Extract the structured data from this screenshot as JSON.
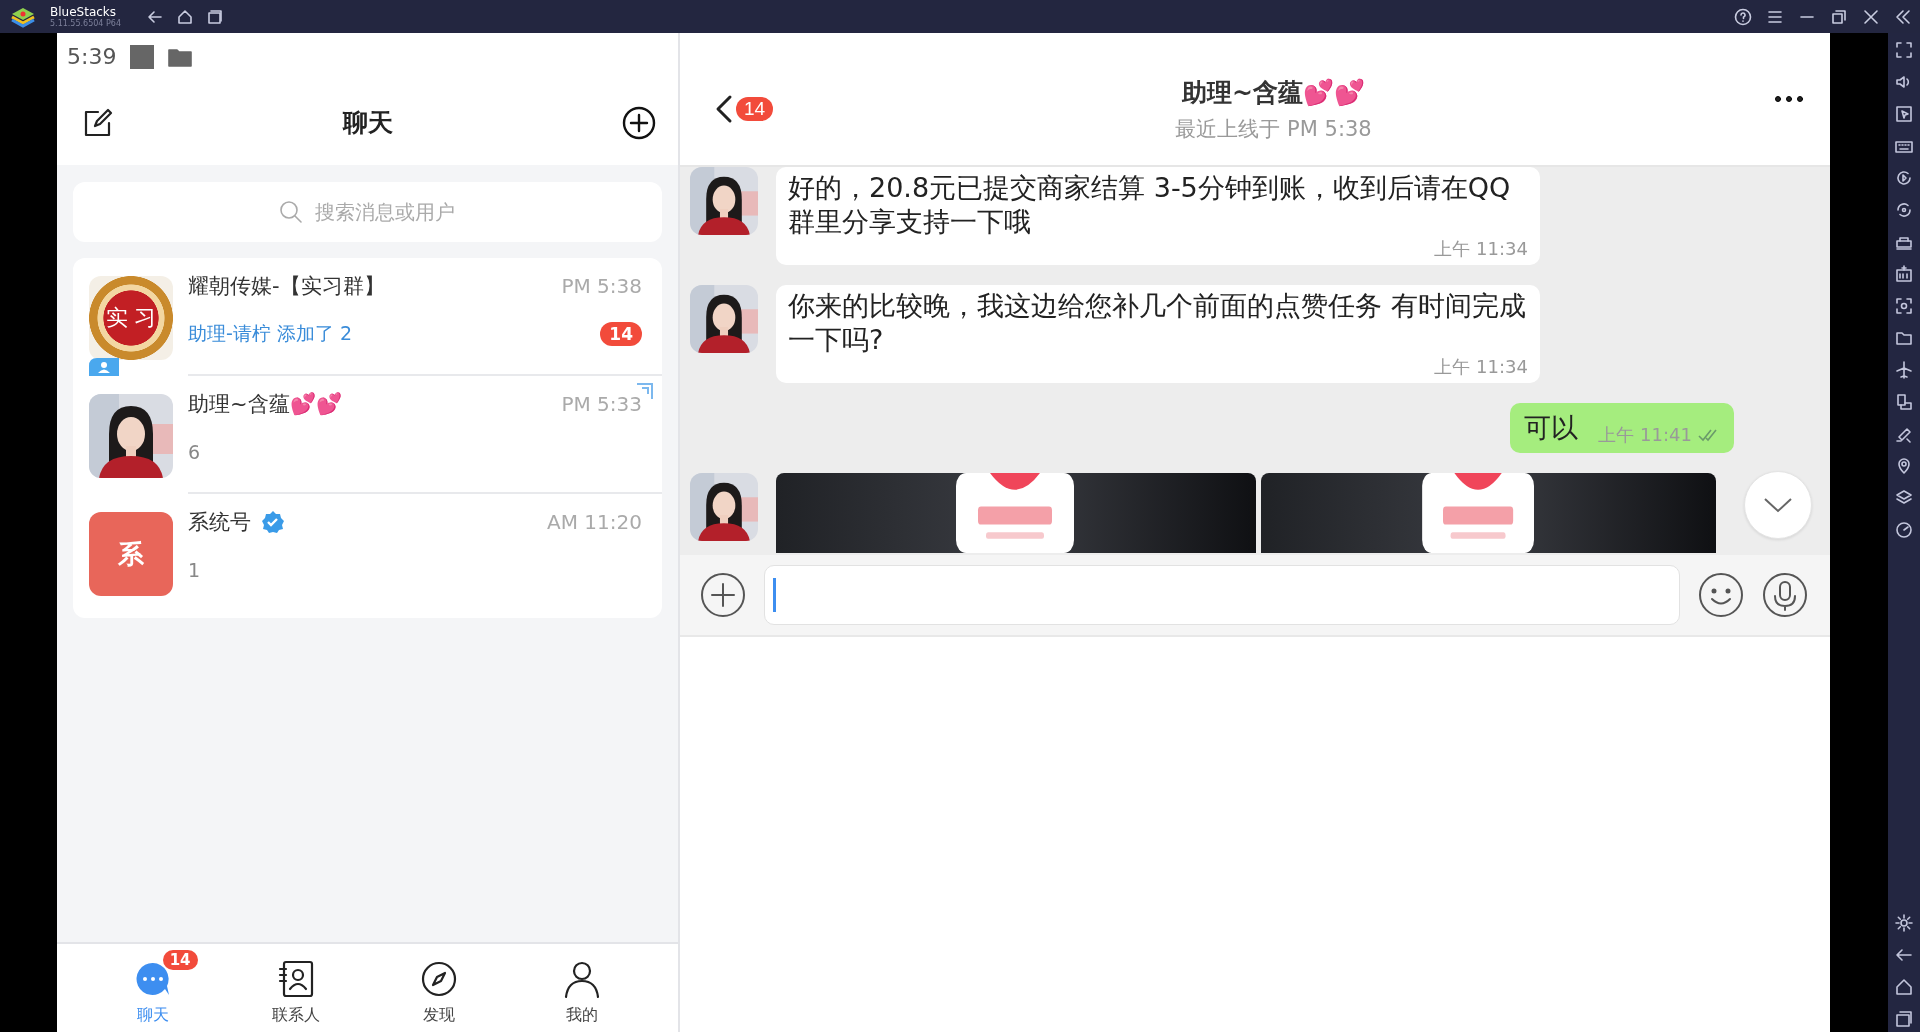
{
  "emulator": {
    "app_name": "BlueStacks",
    "version": "5.11.55.6504 P64"
  },
  "status_bar": {
    "time": "5:39"
  },
  "chat_list": {
    "title": "聊天",
    "search": {
      "placeholder": "搜索消息或用户"
    },
    "conversations": [
      {
        "name": "耀朝传媒-【实习群】",
        "time": "PM 5:38",
        "preview": "助理-请柠 添加了 2",
        "highlight": true,
        "unread": "14",
        "avatar": {
          "kind": "seal",
          "text": "实 习"
        },
        "group": true,
        "verified": false,
        "pinned": false
      },
      {
        "name": "助理~含蕴💕💕",
        "time": "PM 5:33",
        "preview": "6",
        "highlight": false,
        "group": false,
        "verified": false,
        "pinned": true
      },
      {
        "name": "系统号",
        "time": "AM 11:20",
        "preview": "1",
        "highlight": false,
        "avatar": {
          "kind": "letter",
          "text": "系"
        },
        "group": false,
        "verified": true,
        "pinned": false
      }
    ]
  },
  "chat": {
    "title": "助理~含蕴💕💕",
    "subtitle": "最近上线于 PM 5:38",
    "back_badge": "14",
    "messages": [
      {
        "kind": "incoming",
        "text": "好的，20.8元已提交商家结算 3-5分钟到账，收到后请在QQ群里分享支持一下哦",
        "time": "上午 11:34"
      },
      {
        "kind": "incoming",
        "text": "你来的比较晚，我这边给您补几个前面的点赞任务 有时间完成一下吗?",
        "time": "上午 11:34"
      },
      {
        "kind": "outgoing",
        "text": "可以",
        "time": "上午 11:41",
        "read": true
      },
      {
        "kind": "images"
      }
    ]
  },
  "bottom_nav": [
    {
      "label": "聊天",
      "selected": true,
      "badge": "14"
    },
    {
      "label": "联系人",
      "selected": false
    },
    {
      "label": "发现",
      "selected": false
    },
    {
      "label": "我的",
      "selected": false
    }
  ]
}
